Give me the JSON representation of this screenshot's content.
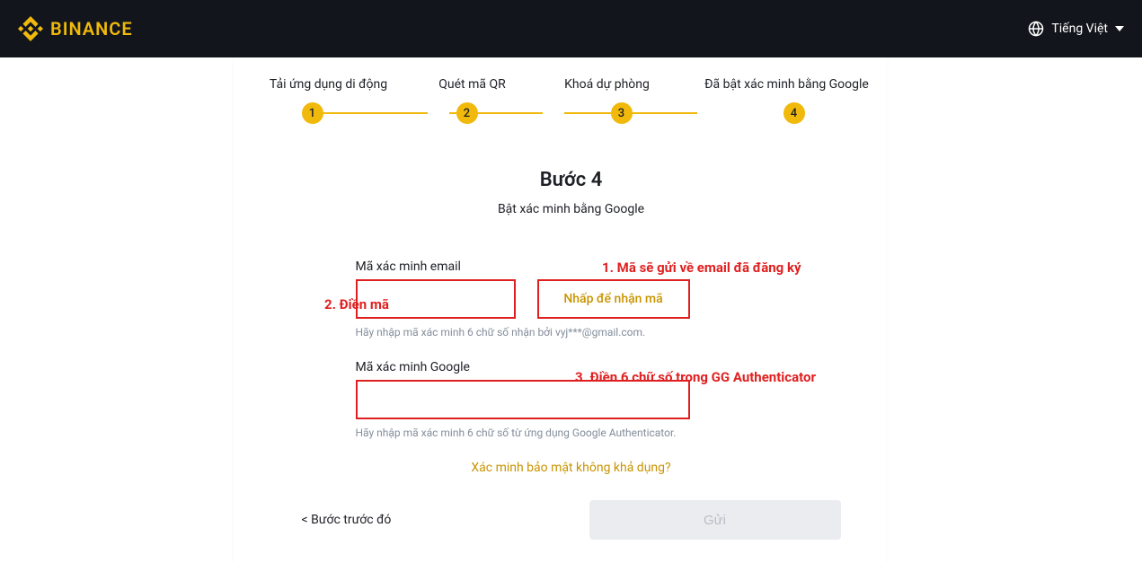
{
  "header": {
    "brand": "BINANCE",
    "language": "Tiếng Việt"
  },
  "steps": {
    "labels": [
      "Tải ứng dụng di động",
      "Quét mã QR",
      "Khoá dự phòng",
      "Đã bật xác minh bằng Google"
    ],
    "numbers": [
      "1",
      "2",
      "3",
      "4"
    ]
  },
  "page": {
    "title": "Bước 4",
    "subtitle": "Bật xác minh bằng Google"
  },
  "form": {
    "email_label": "Mã xác minh email",
    "get_code_button": "Nhấp để nhận mã",
    "email_helper": "Hãy nhập mã xác minh 6 chữ số nhận bởi vyj***@gmail.com.",
    "google_label": "Mã xác minh Google",
    "google_helper": "Hãy nhập mã xác minh 6 chữ số từ ứng dụng Google Authenticator.",
    "unavailable_link": "Xác minh bảo mật không khả dụng?",
    "prev_button": "< Bước trước đó",
    "submit_button": "Gửi"
  },
  "annotations": {
    "a1": "1. Mã sẽ gửi về email đã đăng ký",
    "a2": "2. Điền mã",
    "a3": "3. Điền 6 chữ số trong GG Authenticator"
  }
}
